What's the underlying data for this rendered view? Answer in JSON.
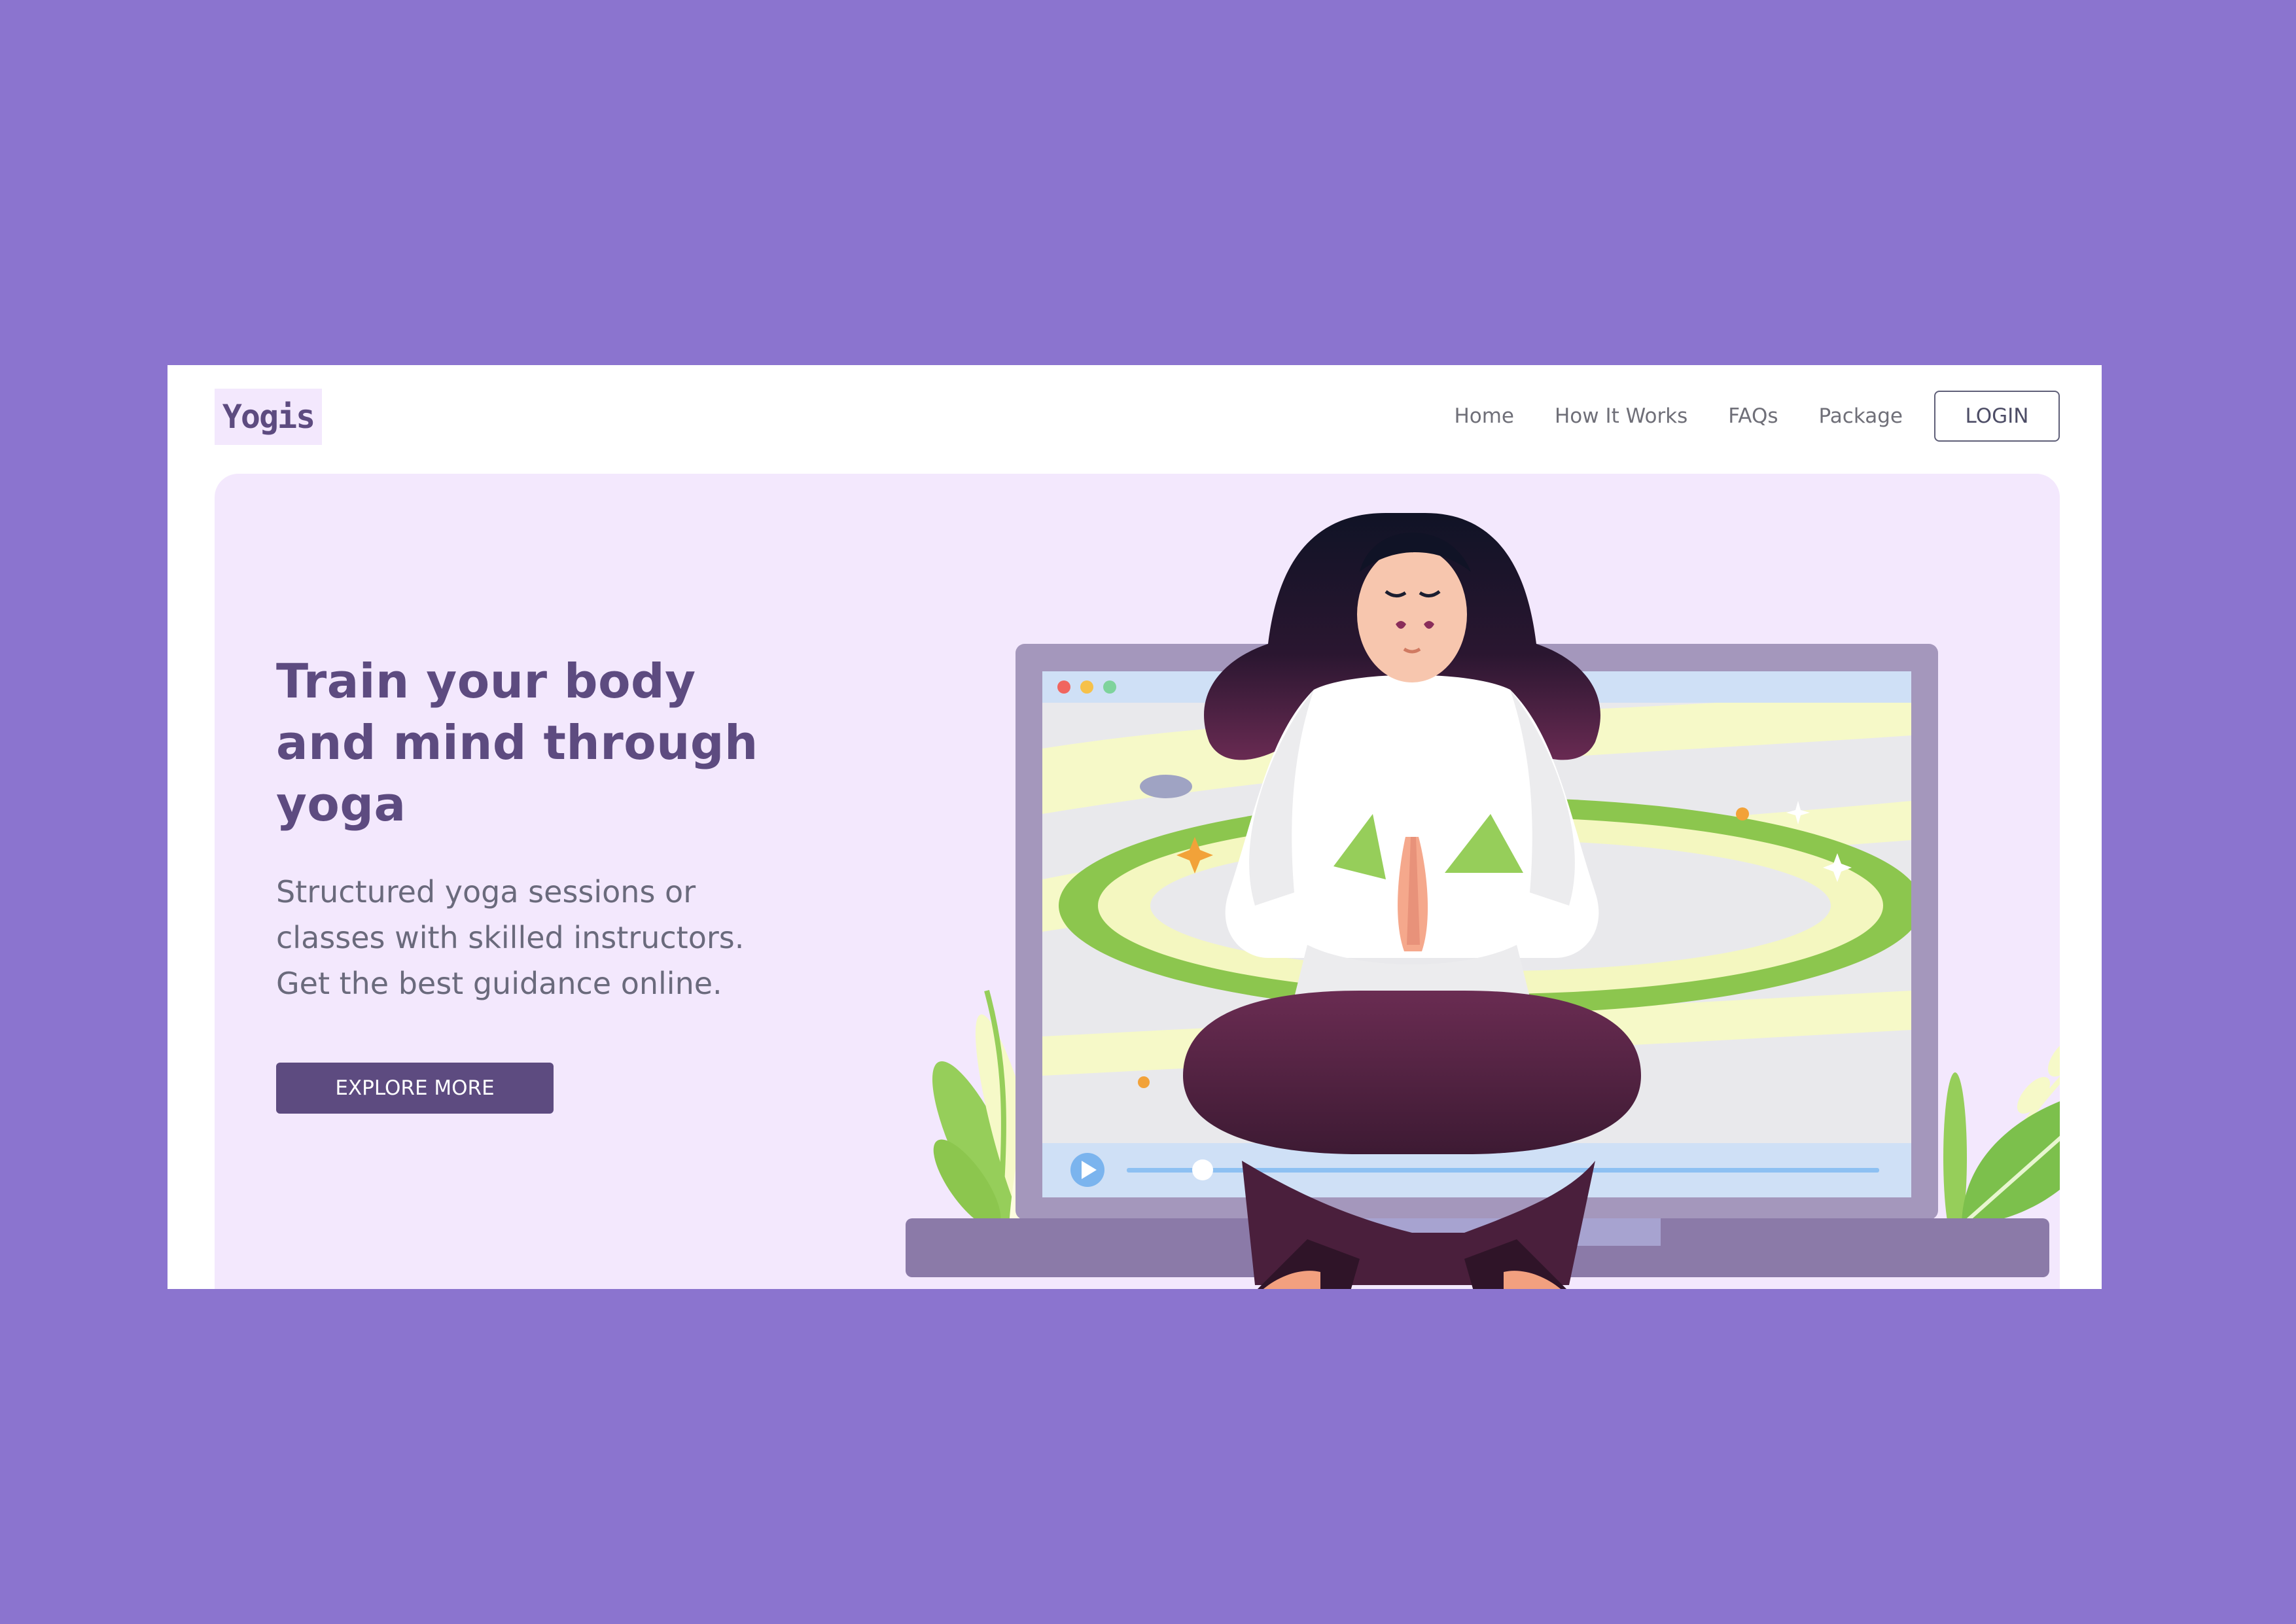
{
  "brand": {
    "logo": "Yogis"
  },
  "nav": {
    "links": [
      "Home",
      "How It Works",
      "FAQs",
      "Package"
    ],
    "login_label": "LOGIN"
  },
  "hero": {
    "headline": "Train your body and mind through yoga",
    "subtext": "Structured yoga sessions or classes with skilled instructors. Get the best guidance online.",
    "cta_label": "EXPLORE MORE"
  },
  "colors": {
    "outer_background": "#8B74CF",
    "hero_background": "#F3E8FD",
    "primary": "#5D4B80",
    "nav_text": "#6F6F78"
  },
  "illustration": {
    "icons": [
      "meditating-woman",
      "laptop",
      "video-player",
      "play-icon",
      "plant-left",
      "leaf-right"
    ]
  }
}
